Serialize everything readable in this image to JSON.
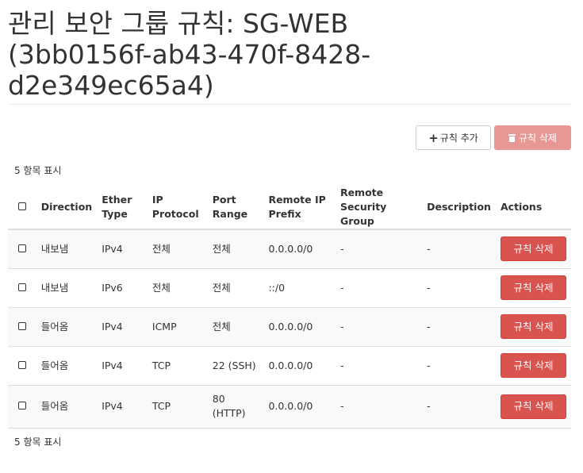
{
  "header": {
    "title": "관리 보안 그룹 규칙: SG-WEB (3bb0156f-ab43-470f-8428-d2e349ec65a4)"
  },
  "toolbar": {
    "add_label": "규칙 추가",
    "delete_label": "규칙 삭제"
  },
  "table": {
    "count_top": "5 항목 표시",
    "count_bottom": "5 항목 표시",
    "columns": [
      "Direction",
      "Ether Type",
      "IP Protocol",
      "Port Range",
      "Remote IP Prefix",
      "Remote Security Group",
      "Description",
      "Actions"
    ],
    "rows": [
      {
        "direction": "내보냄",
        "ether_type": "IPv4",
        "ip_protocol": "전체",
        "port_range": "전체",
        "remote_ip_prefix": "0.0.0.0/0",
        "remote_security_group": "-",
        "description": "-",
        "action_label": "규칙 삭제"
      },
      {
        "direction": "내보냄",
        "ether_type": "IPv6",
        "ip_protocol": "전체",
        "port_range": "전체",
        "remote_ip_prefix": "::/0",
        "remote_security_group": "-",
        "description": "-",
        "action_label": "규칙 삭제"
      },
      {
        "direction": "들어옴",
        "ether_type": "IPv4",
        "ip_protocol": "ICMP",
        "port_range": "전체",
        "remote_ip_prefix": "0.0.0.0/0",
        "remote_security_group": "-",
        "description": "-",
        "action_label": "규칙 삭제"
      },
      {
        "direction": "들어옴",
        "ether_type": "IPv4",
        "ip_protocol": "TCP",
        "port_range": "22 (SSH)",
        "remote_ip_prefix": "0.0.0.0/0",
        "remote_security_group": "-",
        "description": "-",
        "action_label": "규칙 삭제"
      },
      {
        "direction": "들어옴",
        "ether_type": "IPv4",
        "ip_protocol": "TCP",
        "port_range": "80 (HTTP)",
        "remote_ip_prefix": "0.0.0.0/0",
        "remote_security_group": "-",
        "description": "-",
        "action_label": "규칙 삭제"
      }
    ]
  },
  "icons": {
    "add": "plus-icon",
    "delete": "trash-icon",
    "checkbox": "checkbox-icon"
  },
  "colors": {
    "danger": "#d9534f",
    "danger_disabled": "#e89894",
    "text": "#333333",
    "row_stripe": "#f9f9f9"
  }
}
